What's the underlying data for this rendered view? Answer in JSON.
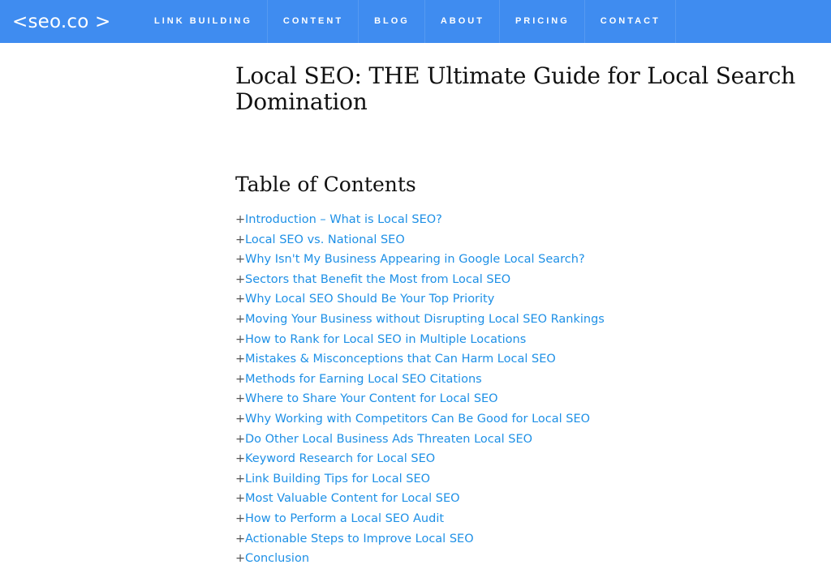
{
  "brand": {
    "logo_text": "<seo.co >",
    "colors": {
      "nav_background": "#3f8cf0",
      "link": "#1e90e6",
      "heading": "#111111"
    }
  },
  "nav": {
    "items": [
      {
        "label": "LINK BUILDING"
      },
      {
        "label": "CONTENT"
      },
      {
        "label": "BLOG"
      },
      {
        "label": "ABOUT"
      },
      {
        "label": "PRICING"
      },
      {
        "label": "CONTACT"
      }
    ]
  },
  "article": {
    "title": "Local SEO: THE Ultimate Guide for Local Search Domination",
    "toc": {
      "heading": "Table of Contents",
      "expand_symbol": "+",
      "items": [
        {
          "label": "Introduction – What is Local SEO?"
        },
        {
          "label": "Local SEO vs. National SEO"
        },
        {
          "label": "Why Isn't My Business Appearing in Google Local Search?"
        },
        {
          "label": "Sectors that Benefit the Most from Local SEO"
        },
        {
          "label": "Why Local SEO Should Be Your Top Priority"
        },
        {
          "label": "Moving Your Business without Disrupting Local SEO Rankings"
        },
        {
          "label": "How to Rank for Local SEO in Multiple Locations"
        },
        {
          "label": "Mistakes & Misconceptions that Can Harm Local SEO"
        },
        {
          "label": "Methods for Earning Local SEO Citations"
        },
        {
          "label": "Where to Share Your Content for Local SEO"
        },
        {
          "label": "Why Working with Competitors Can Be Good for Local SEO"
        },
        {
          "label": "Do Other Local Business Ads Threaten Local SEO"
        },
        {
          "label": "Keyword Research for Local SEO"
        },
        {
          "label": "Link Building Tips for Local SEO"
        },
        {
          "label": "Most Valuable Content for Local SEO"
        },
        {
          "label": "How to Perform a Local SEO Audit"
        },
        {
          "label": "Actionable Steps to Improve Local SEO"
        },
        {
          "label": "Conclusion"
        }
      ]
    }
  }
}
